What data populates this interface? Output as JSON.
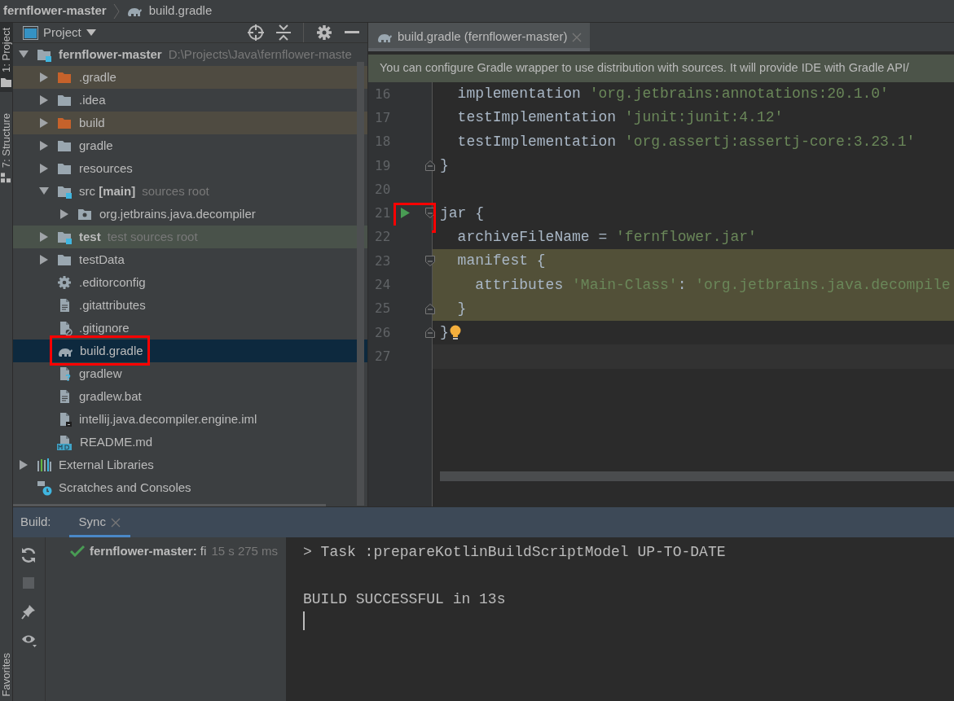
{
  "breadcrumb": [
    {
      "label": "fernflower-master",
      "kind": "module"
    },
    {
      "label": "build.gradle",
      "kind": "gradle-file"
    }
  ],
  "left_strip": {
    "top_tabs": [
      {
        "label": "1: Project",
        "kind": "project",
        "selected": true
      },
      {
        "label": "7: Structure",
        "kind": "structure",
        "selected": false
      }
    ],
    "bottom_tabs": [
      {
        "label": "Favorites",
        "selected": false
      }
    ]
  },
  "project_panel": {
    "title": "Project",
    "tree": [
      {
        "label": "fernflower-master",
        "hint": "D:\\Projects\\Java\\fernflower-maste",
        "kind": "module",
        "expanded": true,
        "selected": false,
        "children": [
          {
            "label": ".gradle",
            "kind": "excluded-folder",
            "expanded": false,
            "selected": false
          },
          {
            "label": ".idea",
            "kind": "folder",
            "expanded": false,
            "selected": false
          },
          {
            "label": "build",
            "kind": "excluded-folder",
            "expanded": false,
            "selected": false
          },
          {
            "label": "gradle",
            "kind": "folder",
            "expanded": false,
            "selected": false
          },
          {
            "label": "resources",
            "kind": "folder",
            "expanded": false,
            "selected": false
          },
          {
            "label": "src **[main]**",
            "hint": "sources root",
            "kind": "source-folder",
            "expanded": true,
            "selected": false,
            "children": [
              {
                "label": "org.jetbrains.java.decompiler",
                "kind": "package",
                "expanded": false,
                "selected": false
              }
            ]
          },
          {
            "label": "test",
            "hint": "test sources root",
            "kind": "test-folder",
            "expanded": false,
            "selected": false
          },
          {
            "label": "testData",
            "kind": "folder",
            "expanded": false,
            "selected": false
          },
          {
            "label": ".editorconfig",
            "kind": "settings-file",
            "selected": false
          },
          {
            "label": ".gitattributes",
            "kind": "text-file",
            "selected": false
          },
          {
            "label": ".gitignore",
            "kind": "ignore-file",
            "selected": false
          },
          {
            "label": "build.gradle",
            "kind": "gradle-file",
            "selected": true,
            "marked": true
          },
          {
            "label": "gradlew",
            "kind": "unknown-file",
            "selected": false
          },
          {
            "label": "gradlew.bat",
            "kind": "text-file",
            "selected": false
          },
          {
            "label": "intellij.java.decompiler.engine.iml",
            "kind": "module-file",
            "selected": false
          },
          {
            "label": "README.md",
            "kind": "markdown-file",
            "selected": false
          }
        ]
      },
      {
        "label": "External Libraries",
        "kind": "libraries",
        "expanded": false,
        "selected": false
      },
      {
        "label": "Scratches and Consoles",
        "kind": "scratches",
        "selected": false
      }
    ]
  },
  "editor": {
    "tabs": [
      {
        "label": "build.gradle (fernflower-master)",
        "kind": "gradle-file",
        "selected": true
      }
    ],
    "banner": "You can configure Gradle wrapper to use distribution with sources. It will provide IDE with Gradle API/",
    "lines": [
      {
        "number": "16",
        "tokens": [
          {
            "text": "  implementation ",
            "kind": "plain"
          },
          {
            "text": "'org.jetbrains:annotations:20.1.0'",
            "kind": "string"
          }
        ]
      },
      {
        "number": "17",
        "tokens": [
          {
            "text": "  testImplementation ",
            "kind": "plain"
          },
          {
            "text": "'junit:junit:4.12'",
            "kind": "string"
          }
        ]
      },
      {
        "number": "18",
        "tokens": [
          {
            "text": "  testImplementation ",
            "kind": "plain"
          },
          {
            "text": "'org.assertj:assertj-core:3.23.1'",
            "kind": "string"
          }
        ]
      },
      {
        "number": "19",
        "fold_end": true,
        "tokens": [
          {
            "text": "}",
            "kind": "plain"
          }
        ]
      },
      {
        "number": "20"
      },
      {
        "number": "21",
        "fold_start": true,
        "run": true,
        "marked": true,
        "tokens": [
          {
            "text": "jar {",
            "kind": "plain"
          }
        ]
      },
      {
        "number": "22",
        "tokens": [
          {
            "text": "  archiveFileName = ",
            "kind": "plain"
          },
          {
            "text": "'fernflower.jar'",
            "kind": "string"
          }
        ]
      },
      {
        "number": "23",
        "fold_start": true,
        "highlighted": true,
        "tokens": [
          {
            "text": "  manifest {",
            "kind": "plain"
          }
        ]
      },
      {
        "number": "24",
        "highlighted": true,
        "tokens": [
          {
            "text": "    attributes ",
            "kind": "plain"
          },
          {
            "text": "'Main-Class'",
            "kind": "string"
          },
          {
            "text": ": ",
            "kind": "plain"
          },
          {
            "text": "'org.jetbrains.java.decompile",
            "kind": "string"
          }
        ]
      },
      {
        "number": "25",
        "fold_end": true,
        "highlighted": true,
        "tokens": [
          {
            "text": "  }",
            "kind": "plain"
          }
        ]
      },
      {
        "number": "26",
        "fold_end": true,
        "bulb": true,
        "tokens": [
          {
            "text": "}",
            "kind": "plain"
          }
        ]
      },
      {
        "number": "27",
        "current": true
      }
    ]
  },
  "build_panel": {
    "label": "Build:",
    "tabs": [
      {
        "label": "Sync",
        "selected": true
      }
    ],
    "tool_buttons": [
      {
        "kind": "rerun",
        "disabled": false
      },
      {
        "kind": "stop",
        "disabled": true
      },
      {
        "kind": "pin",
        "disabled": false
      },
      {
        "kind": "view-options",
        "disabled": false
      }
    ],
    "tree": [
      {
        "succeeded": true,
        "label": "**fernflower-master:** fi",
        "time": "15 s 275 ms"
      }
    ],
    "console": [
      "> Task :prepareKotlinBuildScriptModel UP-TO-DATE",
      "BUILD SUCCESSFUL in 13s"
    ]
  }
}
